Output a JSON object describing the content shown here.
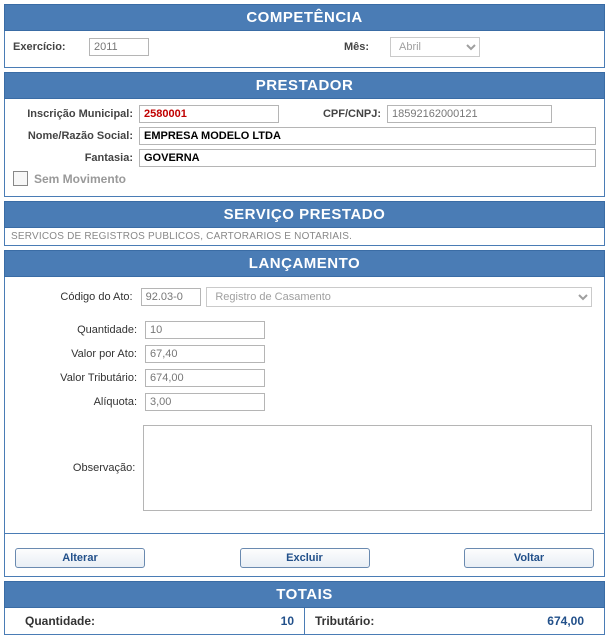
{
  "competencia": {
    "title": "COMPETÊNCIA",
    "exercicio_label": "Exercício:",
    "exercicio_value": "2011",
    "mes_label": "Mês:",
    "mes_value": "Abril"
  },
  "prestador": {
    "title": "PRESTADOR",
    "inscricao_label": "Inscrição Municipal:",
    "inscricao_value": "2580001",
    "cpfcnpj_label": "CPF/CNPJ:",
    "cpfcnpj_value": "18592162000121",
    "razao_label": "Nome/Razão Social:",
    "razao_value": "EMPRESA MODELO LTDA",
    "fantasia_label": "Fantasia:",
    "fantasia_value": "GOVERNA",
    "sem_mov_label": "Sem Movimento"
  },
  "servico": {
    "title": "SERVIÇO PRESTADO",
    "descricao": "SERVICOS DE REGISTROS PUBLICOS, CARTORARIOS E NOTARIAIS."
  },
  "lancamento": {
    "title": "LANÇAMENTO",
    "codigo_label": "Código do Ato:",
    "codigo_value": "92.03-0",
    "codigo_desc": "Registro de Casamento",
    "quantidade_label": "Quantidade:",
    "quantidade_value": "10",
    "valor_ato_label": "Valor por Ato:",
    "valor_ato_value": "67,40",
    "valor_trib_label": "Valor Tributário:",
    "valor_trib_value": "674,00",
    "aliquota_label": "Alíquota:",
    "aliquota_value": "3,00",
    "obs_label": "Observação:",
    "obs_value": ""
  },
  "buttons": {
    "alterar": "Alterar",
    "excluir": "Excluir",
    "voltar": "Voltar"
  },
  "totais": {
    "title": "TOTAIS",
    "quantidade_label": "Quantidade:",
    "quantidade_value": "10",
    "tributario_label": "Tributário:",
    "tributario_value": "674,00"
  }
}
